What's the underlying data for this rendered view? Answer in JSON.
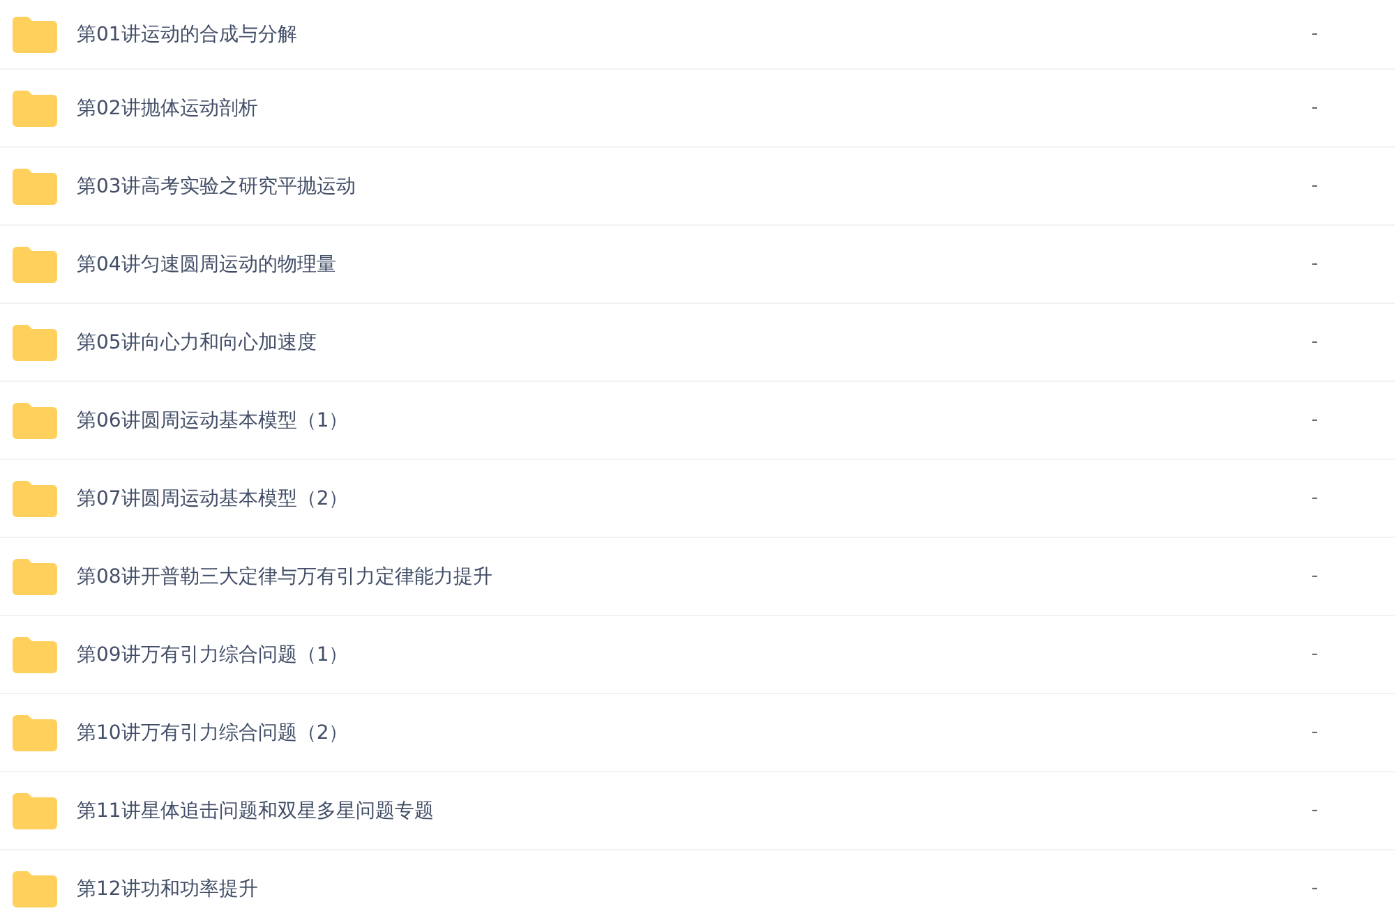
{
  "files": [
    {
      "name": "第01讲运动的合成与分解",
      "size": "-"
    },
    {
      "name": "第02讲抛体运动剖析",
      "size": "-"
    },
    {
      "name": "第03讲高考实验之研究平抛运动",
      "size": "-"
    },
    {
      "name": "第04讲匀速圆周运动的物理量",
      "size": "-"
    },
    {
      "name": "第05讲向心力和向心加速度",
      "size": "-"
    },
    {
      "name": "第06讲圆周运动基本模型（1）",
      "size": "-"
    },
    {
      "name": "第07讲圆周运动基本模型（2）",
      "size": "-"
    },
    {
      "name": "第08讲开普勒三大定律与万有引力定律能力提升",
      "size": "-"
    },
    {
      "name": "第09讲万有引力综合问题（1）",
      "size": "-"
    },
    {
      "name": "第10讲万有引力综合问题（2）",
      "size": "-"
    },
    {
      "name": "第11讲星体追击问题和双星多星问题专题",
      "size": "-"
    },
    {
      "name": "第12讲功和功率提升",
      "size": "-"
    }
  ]
}
